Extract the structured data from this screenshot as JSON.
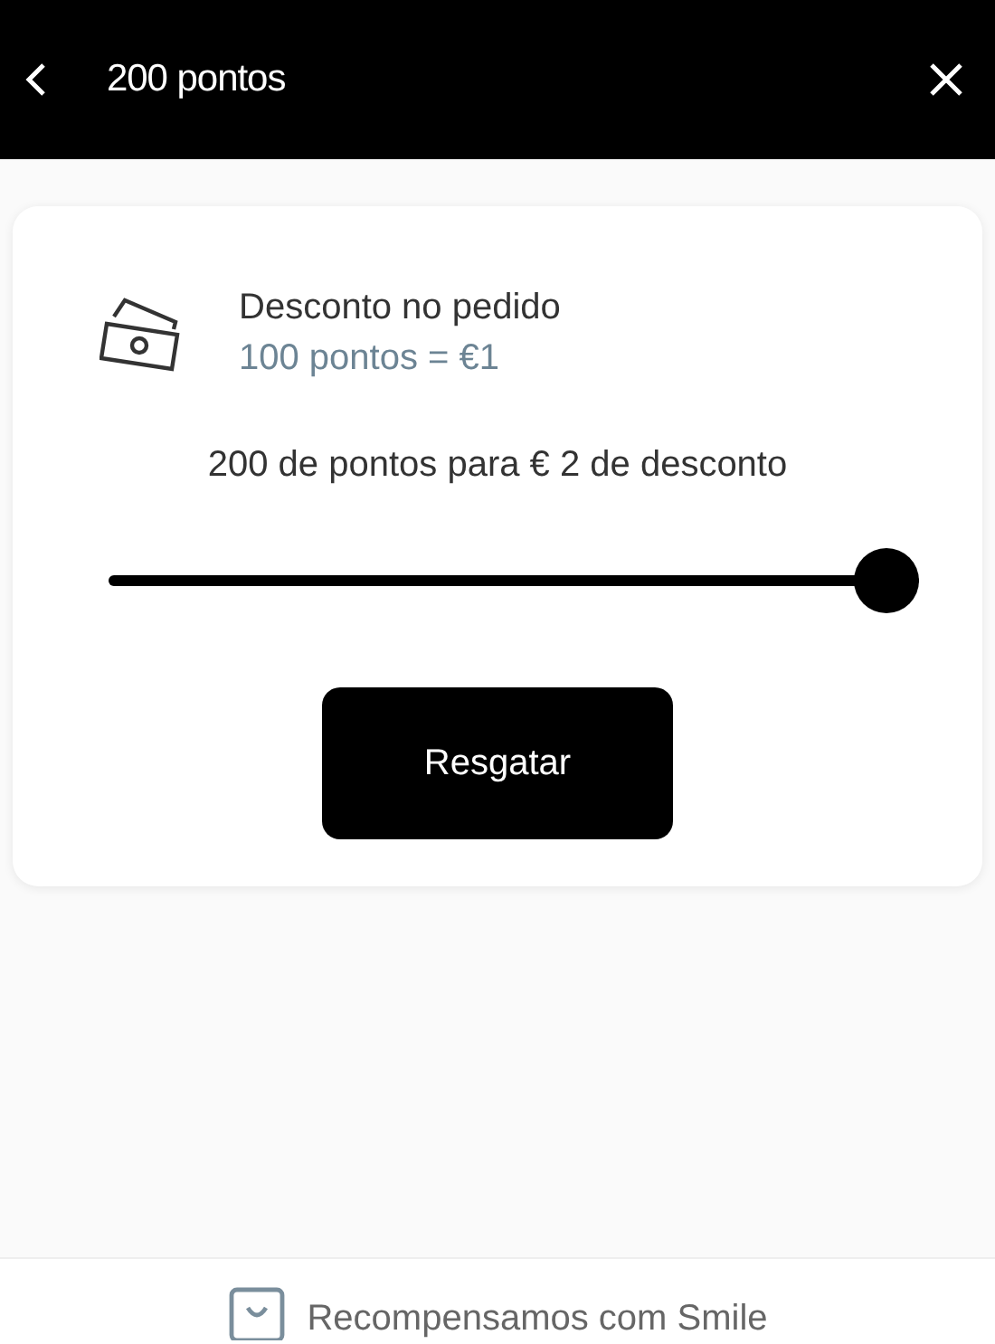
{
  "header": {
    "title": "200 pontos"
  },
  "reward": {
    "title": "Desconto no pedido",
    "rate": "100 pontos = €1"
  },
  "summary": "200 de pontos para € 2 de desconto",
  "slider": {
    "level": 1
  },
  "button": "Resgatar",
  "footer": "Recompensamos com Smile"
}
